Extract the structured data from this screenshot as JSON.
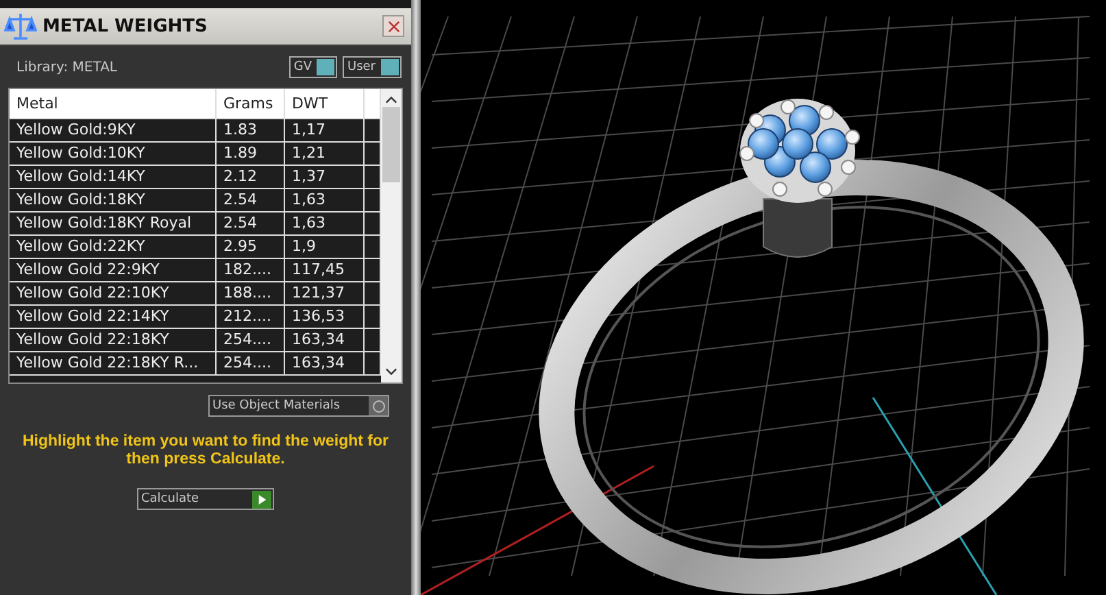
{
  "panel": {
    "title": "METAL WEIGHTS",
    "library_label": "Library: METAL",
    "toggles": [
      {
        "label": "GV",
        "on": true
      },
      {
        "label": "User",
        "on": true
      }
    ],
    "table": {
      "columns": [
        "Metal",
        "Grams",
        "DWT"
      ],
      "rows": [
        [
          "Yellow Gold:9KY",
          "1.83",
          "1,17"
        ],
        [
          "Yellow Gold:10KY",
          "1.89",
          "1,21"
        ],
        [
          "Yellow Gold:14KY",
          "2.12",
          "1,37"
        ],
        [
          "Yellow Gold:18KY",
          "2.54",
          "1,63"
        ],
        [
          "Yellow Gold:18KY Royal",
          "2.54",
          "1,63"
        ],
        [
          "Yellow Gold:22KY",
          "2.95",
          "1,9"
        ],
        [
          "Yellow Gold 22:9KY",
          "182....",
          "117,45"
        ],
        [
          "Yellow Gold 22:10KY",
          "188....",
          "121,37"
        ],
        [
          "Yellow Gold 22:14KY",
          "212....",
          "136,53"
        ],
        [
          "Yellow Gold 22:18KY",
          "254....",
          "163,34"
        ],
        [
          "Yellow Gold 22:18KY R...",
          "254....",
          "163,34"
        ]
      ]
    },
    "use_object_materials": {
      "label": "Use Object Materials",
      "checked": false
    },
    "instruction": "Highlight the item you want to find the weight for then press Calculate.",
    "calculate_button": "Calculate"
  }
}
